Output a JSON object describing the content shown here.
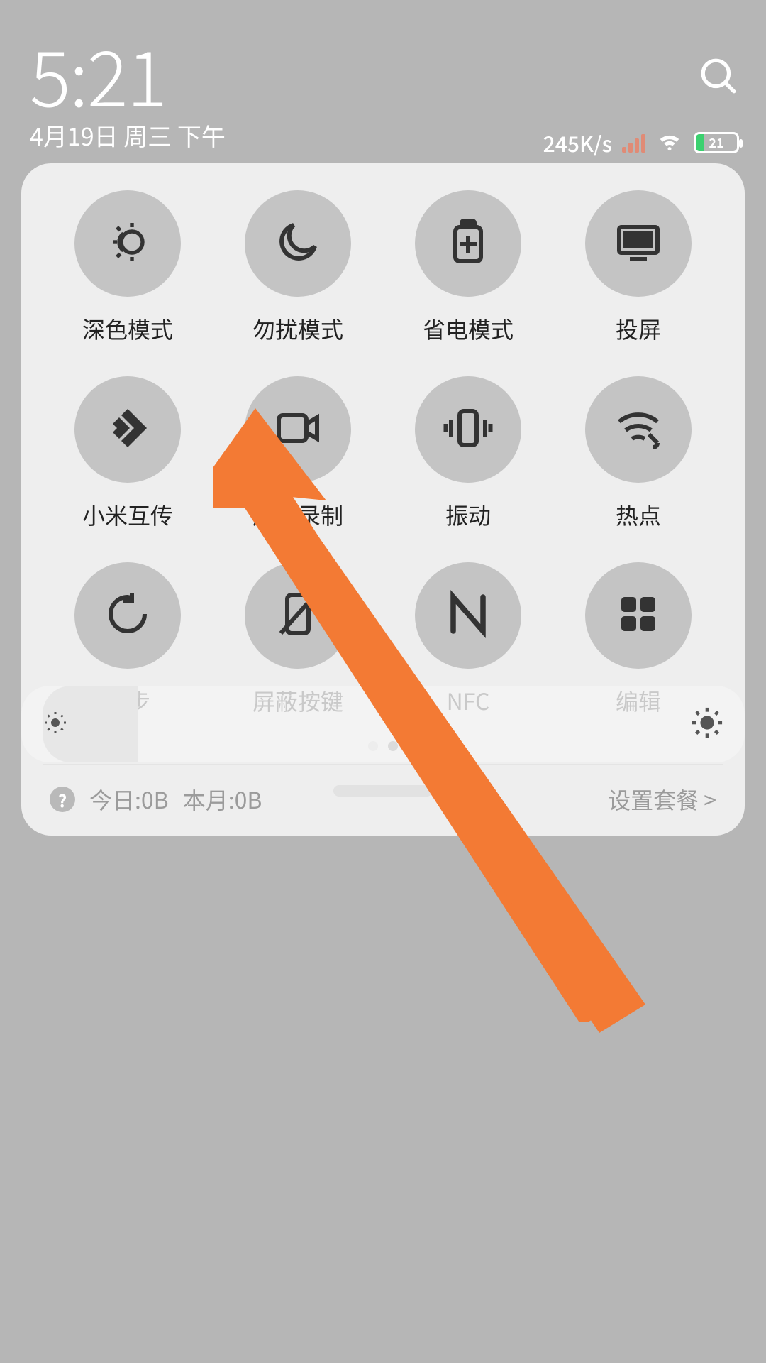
{
  "status": {
    "time": "5:21",
    "date": "4月19日 周三 下午",
    "net_speed": "245K/s",
    "battery_pct": "21"
  },
  "tiles": [
    {
      "id": "dark-mode",
      "label": "深色模式"
    },
    {
      "id": "dnd",
      "label": "勿扰模式"
    },
    {
      "id": "battery-saver",
      "label": "省电模式"
    },
    {
      "id": "cast",
      "label": "投屏"
    },
    {
      "id": "mi-share",
      "label": "小米互传"
    },
    {
      "id": "screen-record",
      "label": "屏幕录制"
    },
    {
      "id": "vibrate",
      "label": "振动"
    },
    {
      "id": "hotspot",
      "label": "热点"
    },
    {
      "id": "sync",
      "label": "同步"
    },
    {
      "id": "hide-keys",
      "label": "屏蔽按键"
    },
    {
      "id": "nfc",
      "label": "NFC"
    },
    {
      "id": "edit",
      "label": "编辑"
    }
  ],
  "data_usage": {
    "today_label": "今日:0B",
    "month_label": "本月:0B",
    "plan_label": "设置套餐 >"
  },
  "annotation": {
    "arrow_color": "#f37a34"
  }
}
